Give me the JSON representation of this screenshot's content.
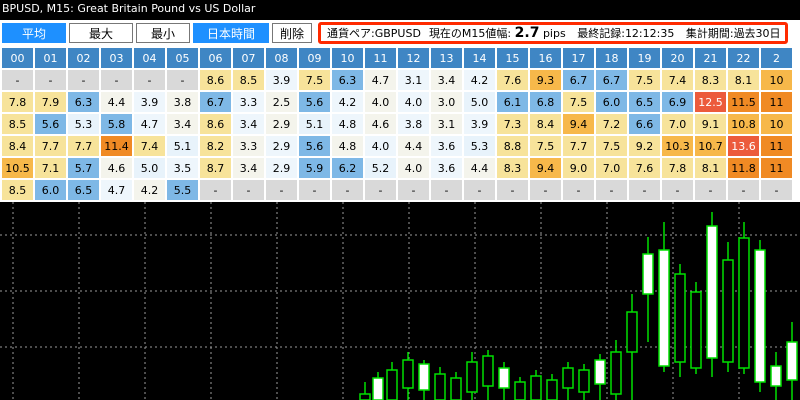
{
  "window": {
    "title": "BPUSD, M15:  Great Britain Pound vs US Dollar"
  },
  "toolbar": {
    "buttons": [
      {
        "label": "平均",
        "active": true
      },
      {
        "label": "最大",
        "active": false
      },
      {
        "label": "最小",
        "active": false
      },
      {
        "label": "日本時間",
        "active": true
      },
      {
        "label": "削除",
        "active": false
      }
    ]
  },
  "info": {
    "pair_label": "通貨ペア:",
    "pair": "GBPUSD",
    "range_label": "現在のM15値幅:",
    "range_value": "2.7",
    "range_unit": "pips",
    "record_label": "最終記録:",
    "record_time": "12:12:35",
    "period_label": "集計期間:",
    "period_value": "過去30日"
  },
  "table": {
    "headers": [
      "00",
      "01",
      "02",
      "03",
      "04",
      "05",
      "06",
      "07",
      "08",
      "09",
      "10",
      "11",
      "12",
      "13",
      "14",
      "15",
      "16",
      "17",
      "18",
      "19",
      "20",
      "21",
      "22",
      "2"
    ],
    "rows": [
      [
        "-",
        "-",
        "-",
        "-",
        "-",
        "-",
        "8.6",
        "8.5",
        "3.9",
        "7.5",
        "6.3",
        "4.7",
        "3.1",
        "3.4",
        "4.2",
        "7.6",
        "9.3",
        "6.7",
        "6.7",
        "7.5",
        "7.4",
        "8.3",
        "8.1",
        "10"
      ],
      [
        "7.8",
        "7.9",
        "6.3",
        "4.4",
        "3.9",
        "3.8",
        "6.7",
        "3.3",
        "2.5",
        "5.6",
        "4.2",
        "4.0",
        "4.0",
        "3.0",
        "5.0",
        "6.1",
        "6.8",
        "7.5",
        "6.0",
        "6.5",
        "6.9",
        "12.5",
        "11.5",
        "11"
      ],
      [
        "8.5",
        "5.6",
        "5.3",
        "5.8",
        "4.7",
        "3.4",
        "8.6",
        "3.4",
        "2.9",
        "5.1",
        "4.8",
        "4.6",
        "3.8",
        "3.1",
        "3.9",
        "7.3",
        "8.4",
        "9.4",
        "7.2",
        "6.6",
        "7.0",
        "9.1",
        "10.8",
        "10"
      ],
      [
        "8.4",
        "7.7",
        "7.7",
        "11.4",
        "7.4",
        "5.1",
        "8.2",
        "3.3",
        "2.9",
        "5.6",
        "4.8",
        "4.0",
        "4.4",
        "3.6",
        "5.3",
        "8.8",
        "7.5",
        "7.7",
        "7.5",
        "9.2",
        "10.3",
        "10.7",
        "13.6",
        "11"
      ],
      [
        "10.5",
        "7.1",
        "5.7",
        "4.6",
        "5.0",
        "3.5",
        "8.7",
        "3.4",
        "2.9",
        "5.9",
        "6.2",
        "5.2",
        "4.0",
        "3.6",
        "4.4",
        "8.3",
        "9.4",
        "9.0",
        "7.0",
        "7.6",
        "7.8",
        "8.1",
        "11.8",
        "11"
      ],
      [
        "8.5",
        "6.0",
        "6.5",
        "4.7",
        "4.2",
        "5.5",
        "-",
        "-",
        "-",
        "-",
        "-",
        "-",
        "-",
        "-",
        "-",
        "-",
        "-",
        "-",
        "-",
        "-",
        "-",
        "-",
        "-",
        "-"
      ]
    ]
  },
  "chart": {
    "background": "#000000",
    "grid_color": "#9a9a9a",
    "up_color": "#00e000",
    "candle_fill": "#ffffff"
  }
}
